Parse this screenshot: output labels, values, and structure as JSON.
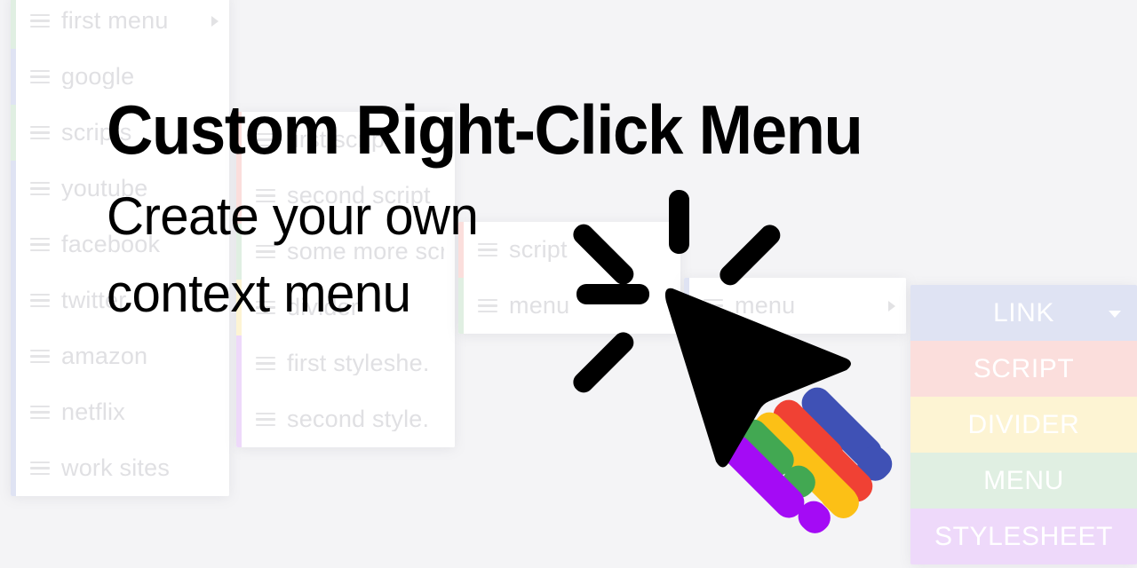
{
  "headline": {
    "title": "Custom Right-Click Menu",
    "subtitle": "Create your own context menu"
  },
  "colors": {
    "background": "#f4f4f6",
    "panel_background": "#ffffff",
    "faded_text": "#e0e0e3",
    "link": "#dfe3f3",
    "script": "#fbdedc",
    "divider": "#fdf4d3",
    "menu": "#e0efe2",
    "stylesheet": "#eed9fa",
    "confetti_blue": "#3f51b5",
    "confetti_red": "#f04134",
    "confetti_yellow": "#fcc016",
    "confetti_green": "#42a852",
    "confetti_purple": "#a40bf5",
    "cursor": "#000000"
  },
  "panels": [
    {
      "name": "first-level-menu",
      "items": [
        {
          "label": "first menu",
          "stripe": "#e0efe2",
          "has_submenu": true
        },
        {
          "label": "google",
          "stripe": "#dfe3f3",
          "has_submenu": false
        },
        {
          "label": "scripts",
          "stripe": "#e0efe2",
          "has_submenu": false
        },
        {
          "label": "youtube",
          "stripe": "#dfe3f3",
          "has_submenu": false
        },
        {
          "label": "facebook",
          "stripe": "#dfe3f3",
          "has_submenu": false
        },
        {
          "label": "twitter",
          "stripe": "#dfe3f3",
          "has_submenu": false
        },
        {
          "label": "amazon",
          "stripe": "#dfe3f3",
          "has_submenu": false
        },
        {
          "label": "netflix",
          "stripe": "#dfe3f3",
          "has_submenu": false
        },
        {
          "label": "work sites",
          "stripe": "#dfe3f3",
          "has_submenu": false
        }
      ]
    },
    {
      "name": "second-level-menu",
      "items": [
        {
          "label": "first script",
          "stripe": "#fbdedc",
          "has_submenu": false
        },
        {
          "label": "second script",
          "stripe": "#fbdedc",
          "has_submenu": false
        },
        {
          "label": "some more scrip...",
          "stripe": "#e0efe2",
          "has_submenu": false
        },
        {
          "label": "divider",
          "stripe": "#fdf4d3",
          "has_submenu": false
        },
        {
          "label": "first styleshe.",
          "stripe": "#eed9fa",
          "has_submenu": false
        },
        {
          "label": "second style.",
          "stripe": "#eed9fa",
          "has_submenu": false
        }
      ]
    },
    {
      "name": "third-level-menu",
      "items": [
        {
          "label": "script",
          "stripe": "#fbdedc",
          "has_submenu": false
        },
        {
          "label": "menu",
          "stripe": "#e0efe2",
          "has_submenu": false
        }
      ]
    },
    {
      "name": "fourth-level-menu",
      "items": [
        {
          "label": "menu",
          "stripe": "#dfe3f3",
          "has_submenu": true
        }
      ]
    }
  ],
  "palette": {
    "name": "item-type-palette",
    "items": [
      {
        "label": "LINK",
        "color": "#dfe3f3",
        "has_dropdown": true
      },
      {
        "label": "SCRIPT",
        "color": "#fbdedc",
        "has_dropdown": false
      },
      {
        "label": "DIVIDER",
        "color": "#fdf4d3",
        "has_dropdown": false
      },
      {
        "label": "MENU",
        "color": "#e0efe2",
        "has_dropdown": false
      },
      {
        "label": "STYLESHEET",
        "color": "#eed9fa",
        "has_dropdown": false
      }
    ]
  },
  "cursor": {
    "icon": "mouse-pointer-click-icon",
    "burst_rays": 6
  }
}
